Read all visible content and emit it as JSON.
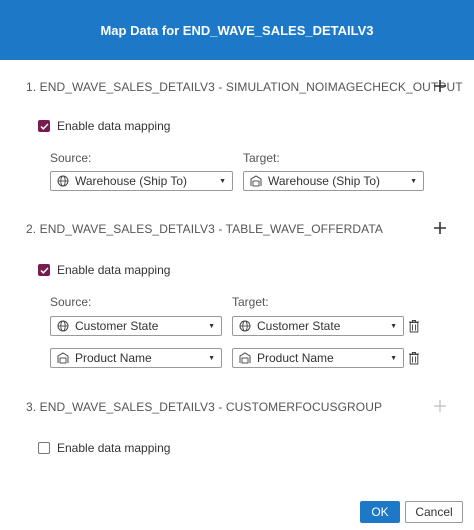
{
  "dialog": {
    "title": "Map Data for END_WAVE_SALES_DETAILV3"
  },
  "sections": [
    {
      "title": "1.  END_WAVE_SALES_DETAILV3 - SIMULATION_NOIMAGECHECK_OUTPUT",
      "enable_label": "Enable data mapping",
      "enabled": true,
      "source_label": "Source:",
      "target_label": "Target:",
      "rows": [
        {
          "source": "Warehouse (Ship To)",
          "source_icon": "globe-icon",
          "target": "Warehouse (Ship To)",
          "target_icon": "warehouse-icon"
        }
      ]
    },
    {
      "title": "2.  END_WAVE_SALES_DETAILV3 - TABLE_WAVE_OFFERDATA",
      "enable_label": "Enable data mapping",
      "enabled": true,
      "source_label": "Source:",
      "target_label": "Target:",
      "rows": [
        {
          "source": "Customer State",
          "source_icon": "globe-icon",
          "target": "Customer State",
          "target_icon": "globe-icon"
        },
        {
          "source": "Product Name",
          "source_icon": "warehouse-icon",
          "target": "Product Name",
          "target_icon": "warehouse-icon"
        }
      ]
    },
    {
      "title": "3.  END_WAVE_SALES_DETAILV3 - CUSTOMERFOCUSGROUP",
      "enable_label": "Enable data mapping",
      "enabled": false
    }
  ],
  "footer": {
    "ok_label": "OK",
    "cancel_label": "Cancel"
  },
  "colors": {
    "accent": "#1d79c8",
    "checkbox": "#7a1b4f"
  }
}
